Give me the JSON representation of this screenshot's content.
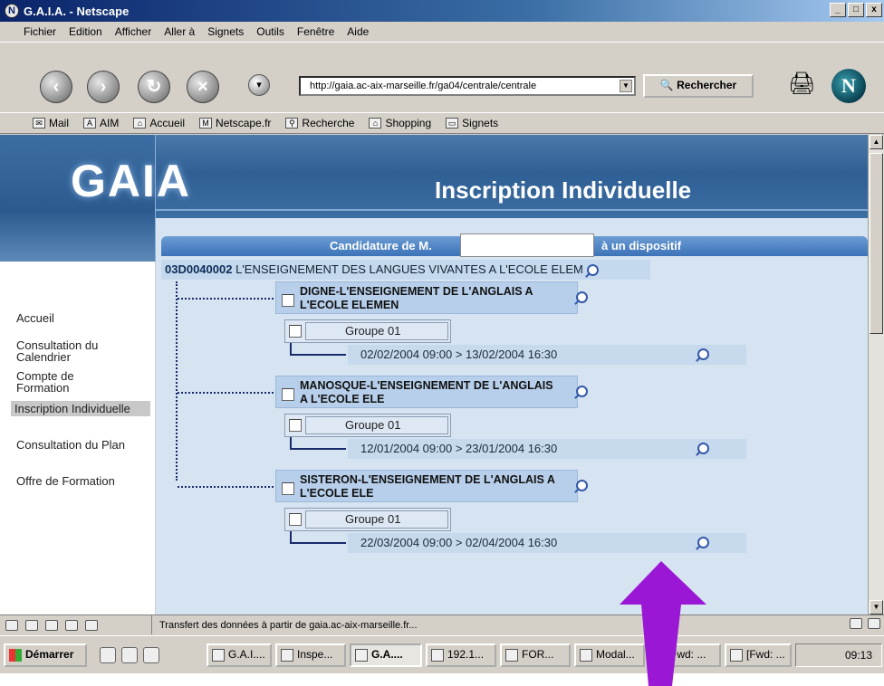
{
  "window": {
    "title": "G.A.I.A. - Netscape",
    "controls": [
      "_",
      "□",
      "x"
    ]
  },
  "menu": [
    "Fichier",
    "Edition",
    "Afficher",
    "Aller à",
    "Signets",
    "Outils",
    "Fenêtre",
    "Aide"
  ],
  "navigation": {
    "url": "http://gaia.ac-aix-marseille.fr/ga04/centrale/centrale",
    "search_label": "Rechercher"
  },
  "personal_toolbar": [
    "Mail",
    "AIM",
    "Accueil",
    "Netscape.fr",
    "Recherche",
    "Shopping",
    "Signets"
  ],
  "page": {
    "logo": "GAIA",
    "title": "Inscription Individuelle",
    "sidebar": [
      "Accueil",
      "Consultation du Calendrier",
      "Compte de Formation",
      "Inscription Individuelle",
      "Consultation du Plan",
      "Offre de Formation"
    ],
    "sidebar_active": "Inscription Individuelle",
    "header_left": "Candidature de M.",
    "header_right": "à un dispositif",
    "dispositif_code": "03D0040002",
    "dispositif_name": "L'ENSEIGNEMENT DES LANGUES VIVANTES A L'ECOLE ELEM",
    "modules": [
      {
        "line1": "DIGNE-L'ENSEIGNEMENT DE L'ANGLAIS A",
        "line2": "L'ECOLE ELEMEN",
        "groupe": "Groupe 01",
        "session": "02/02/2004 09:00 > 13/02/2004 16:30"
      },
      {
        "line1": "MANOSQUE-L'ENSEIGNEMENT DE L'ANGLAIS",
        "line2": "A L'ECOLE ELE",
        "groupe": "Groupe 01",
        "session": "12/01/2004 09:00 > 23/01/2004 16:30"
      },
      {
        "line1": "SISTERON-L'ENSEIGNEMENT DE L'ANGLAIS A",
        "line2": "L'ECOLE ELE",
        "groupe": "Groupe 01",
        "session": "22/03/2004 09:00 > 02/04/2004 16:30"
      }
    ]
  },
  "statusbar": {
    "text": "Transfert des données à partir de gaia.ac-aix-marseille.fr..."
  },
  "taskbar": {
    "start": "Démarrer",
    "tasks": [
      "G.A.I....",
      "Inspe...",
      "G.A....",
      "192.1...",
      "FOR...",
      "Modal...",
      "Fwd: ...",
      "[Fwd: ..."
    ],
    "clock": "09:13"
  },
  "colors": {
    "banner": "#2f5f94",
    "header": "#3c72b8",
    "content_bg": "#d6e4f2",
    "annotation_arrow": "#9b17d6"
  }
}
